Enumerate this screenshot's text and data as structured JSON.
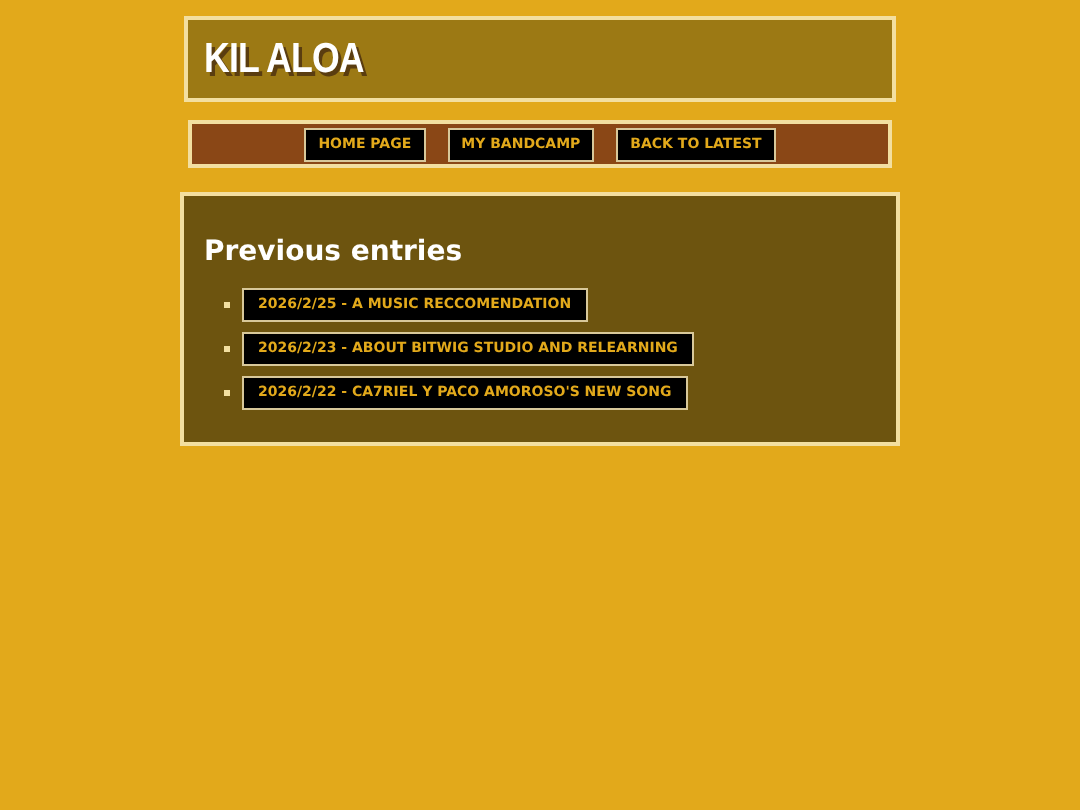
{
  "site_title": "KIL ALOA",
  "nav": [
    "HOME PAGE",
    "MY BANDCAMP",
    "BACK TO LATEST"
  ],
  "heading": "Previous entries",
  "entries": [
    "2026/2/25 - A MUSIC RECCOMENDATION",
    "2026/2/23 - ABOUT BITWIG STUDIO AND RELEARNING",
    "2026/2/22 - CA7RIEL Y PACO AMOROSO'S NEW SONG"
  ]
}
